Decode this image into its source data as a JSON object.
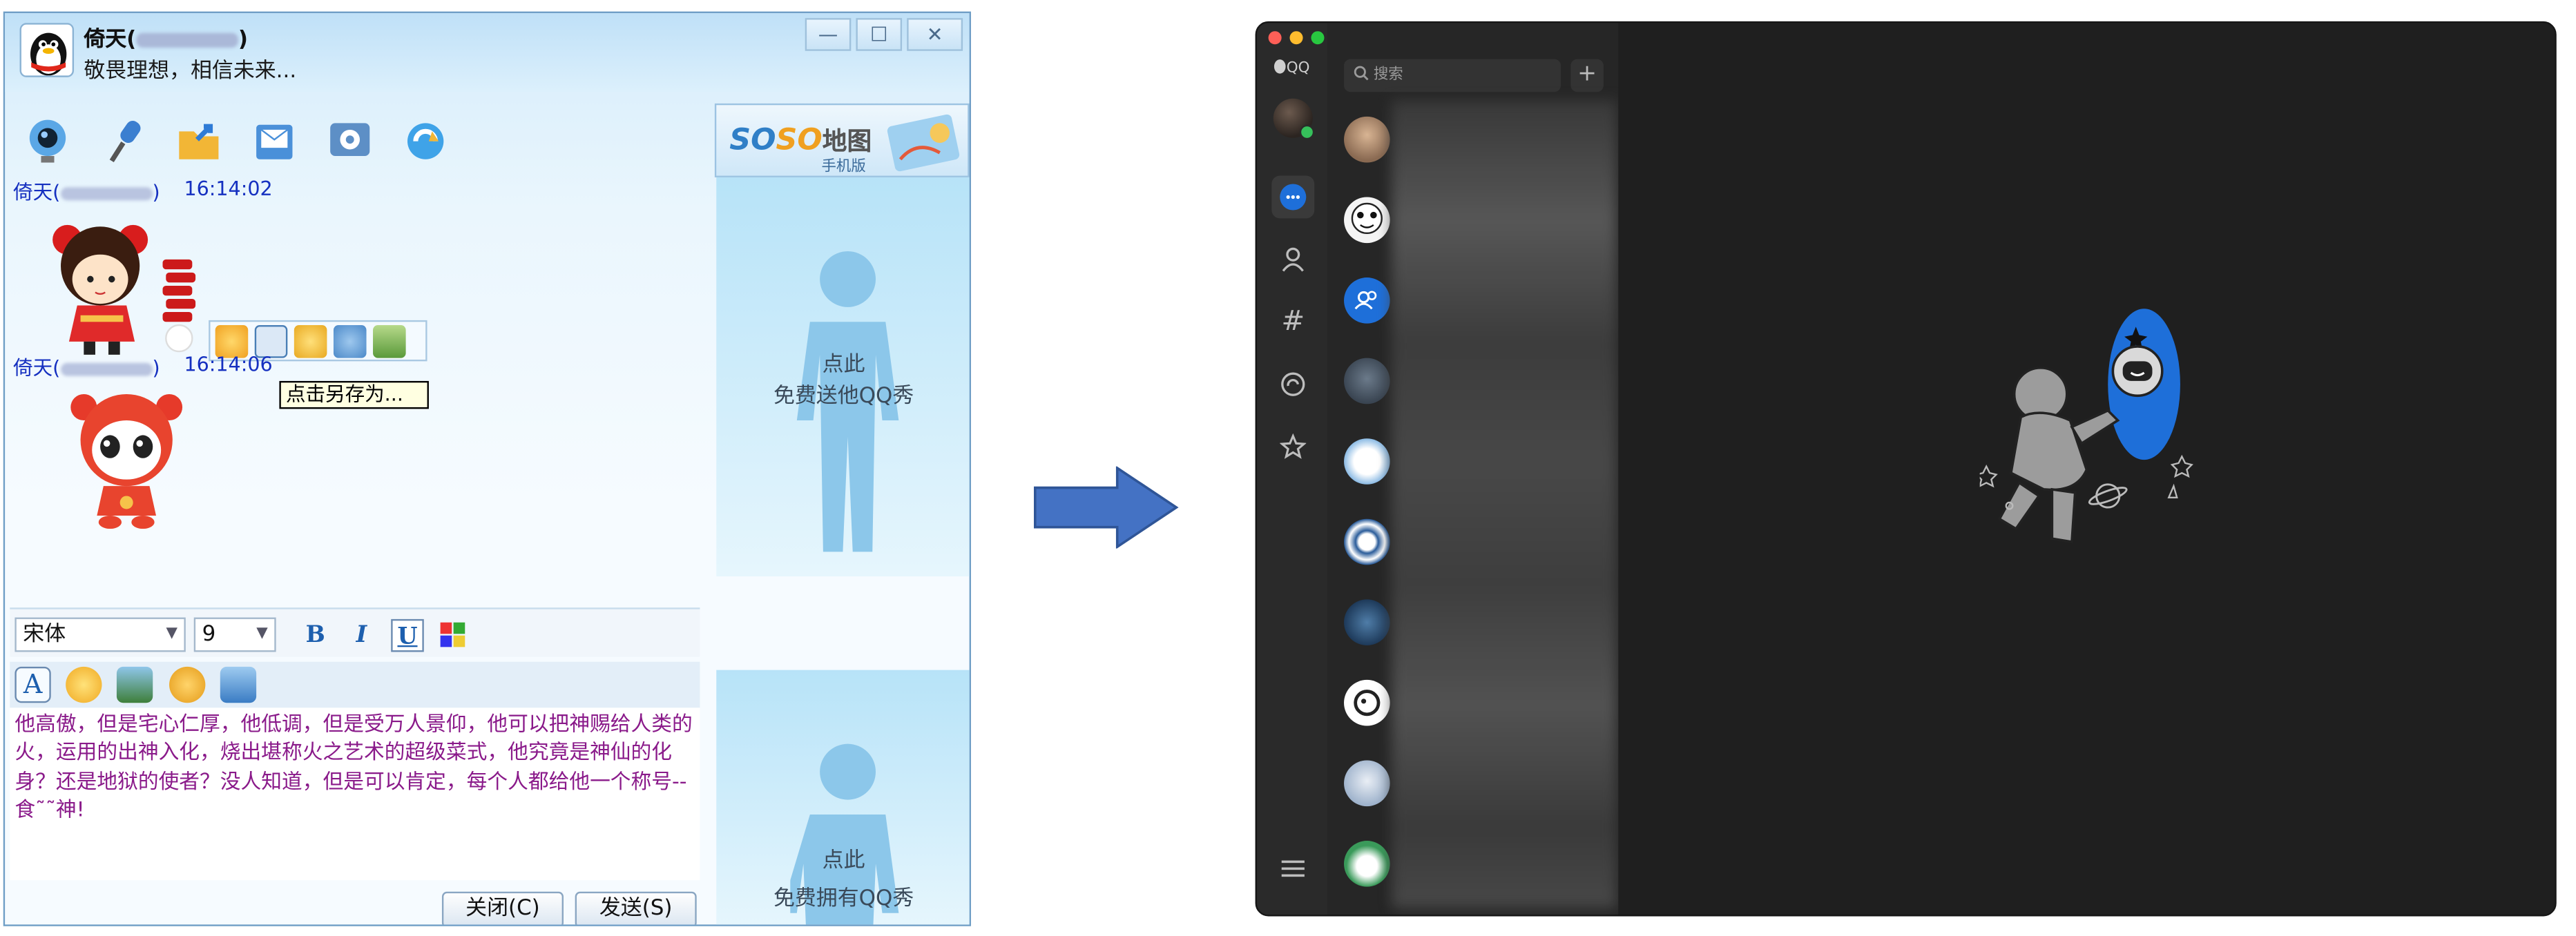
{
  "old_qq": {
    "title_name": "倚天(",
    "title_name_close": ")",
    "signature": "敬畏理想，相信未来...",
    "window_controls": [
      "—",
      "☐",
      "✕"
    ],
    "map_banner": {
      "brand_a": "SO",
      "brand_b": "SO",
      "brand_c": "地图",
      "sub": "手机版"
    },
    "messages": [
      {
        "sender": "倚天(",
        "sender_close": ")",
        "time": "16:14:02"
      },
      {
        "sender": "倚天(",
        "sender_close": ")",
        "time": "16:14:06"
      }
    ],
    "tooltip": "点击另存为...",
    "show_panel_1": {
      "line1": "点此",
      "line2": "免费送他QQ秀"
    },
    "show_panel_2": {
      "line1": "点此",
      "line2": "免费拥有QQ秀"
    },
    "font_name": "宋体",
    "font_size": "9",
    "format_buttons": {
      "bold": "B",
      "italic": "I",
      "underline": "U"
    },
    "input_text": "他高傲，但是宅心仁厚，他低调，但是受万人景仰，他可以把神赐给人类的火，运用的出神入化，烧出堪称火之艺术的超级菜式，他究竟是神仙的化身？还是地狱的使者？没人知道，但是可以肯定，每个人都给他一个称号--食˜˜神!",
    "close_button": "关闭(C)",
    "send_button": "发送(S)"
  },
  "new_qq": {
    "app_tag": "QQ",
    "search_placeholder": "搜索",
    "add_label": "+",
    "accent": "#1e6fd9"
  }
}
